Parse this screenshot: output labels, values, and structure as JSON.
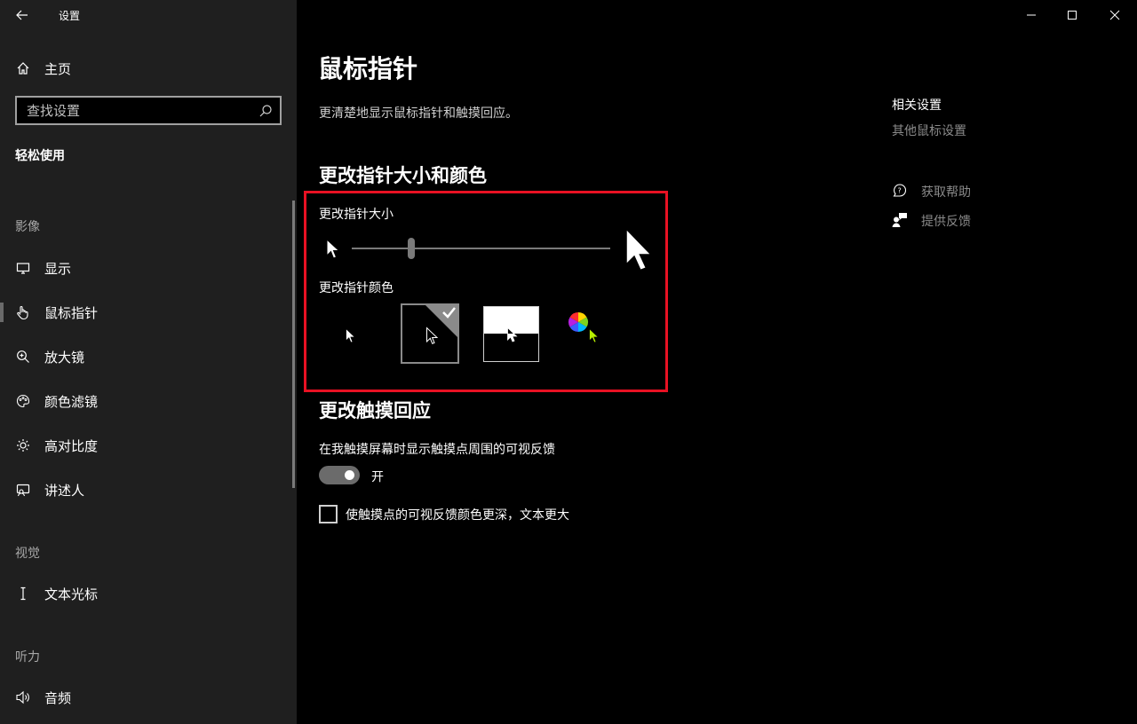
{
  "window": {
    "title": "设置",
    "controls": [
      "minimize",
      "maximize",
      "close"
    ]
  },
  "sidebar": {
    "home_label": "主页",
    "search_placeholder": "查找设置",
    "category": "轻松使用",
    "groups": [
      {
        "label": "影像",
        "items": [
          {
            "label": "显示",
            "icon": "monitor-icon"
          },
          {
            "label": "鼠标指针",
            "icon": "hand-pointer-icon",
            "selected": true
          },
          {
            "label": "放大镜",
            "icon": "magnifier-icon"
          },
          {
            "label": "颜色滤镜",
            "icon": "palette-icon"
          },
          {
            "label": "高对比度",
            "icon": "sun-icon"
          },
          {
            "label": "讲述人",
            "icon": "narrator-icon"
          }
        ]
      },
      {
        "label": "视觉",
        "items": [
          {
            "label": "文本光标",
            "icon": "text-cursor-icon"
          }
        ]
      },
      {
        "label": "听力",
        "items": [
          {
            "label": "音频",
            "icon": "speaker-icon"
          }
        ]
      }
    ]
  },
  "main": {
    "title": "鼠标指针",
    "subtitle": "更清楚地显示鼠标指针和触摸回应。",
    "size_color_section": {
      "heading": "更改指针大小和颜色",
      "size_label": "更改指针大小",
      "size_slider_value": 0.23,
      "color_label": "更改指针颜色",
      "color_options": [
        "white",
        "black",
        "inverted",
        "custom"
      ],
      "selected_color": "black"
    },
    "touch_section": {
      "heading": "更改触摸回应",
      "feedback_label": "在我触摸屏幕时显示触摸点周围的可视反馈",
      "toggle_state": "开",
      "toggle_on": true,
      "checkbox_label": "使触摸点的可视反馈颜色更深，文本更大",
      "checkbox_checked": false
    }
  },
  "related": {
    "title": "相关设置",
    "link": "其他鼠标设置",
    "help": [
      {
        "label": "获取帮助",
        "icon": "help-chat-icon"
      },
      {
        "label": "提供反馈",
        "icon": "feedback-icon"
      }
    ]
  },
  "colors": {
    "highlight_border": "#e81123",
    "sidebar_bg": "#1f1f1f",
    "main_bg": "#000000"
  }
}
